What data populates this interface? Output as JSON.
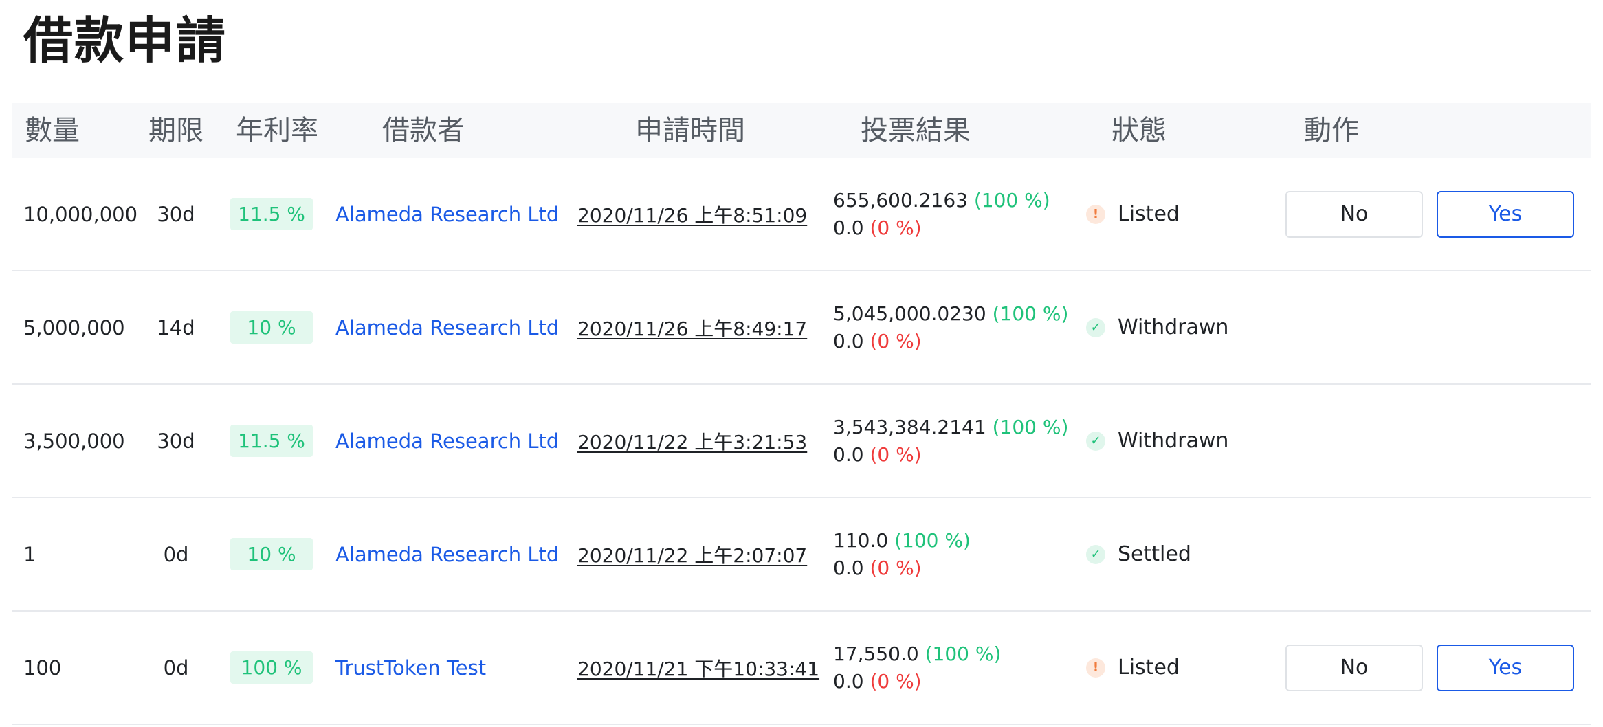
{
  "page": {
    "title": "借款申請"
  },
  "columns": [
    "數量",
    "期限",
    "年利率",
    "借款者",
    "申請時間",
    "投票結果",
    "狀態",
    "動作"
  ],
  "rows": [
    {
      "amount": "10,000,000",
      "term": "30d",
      "rate": "11.5 %",
      "borrower": "Alameda Research Ltd",
      "time": "2020/11/26 上午8:51:09",
      "yes_votes": "655,600.2163",
      "yes_pct": "(100 %)",
      "no_votes": "0.0",
      "no_pct": "(0 %)",
      "status": "Listed",
      "status_icon": "exclamation-icon",
      "show_actions": true
    },
    {
      "amount": "5,000,000",
      "term": "14d",
      "rate": "10 %",
      "borrower": "Alameda Research Ltd",
      "time": "2020/11/26 上午8:49:17",
      "yes_votes": "5,045,000.0230",
      "yes_pct": "(100 %)",
      "no_votes": "0.0",
      "no_pct": "(0 %)",
      "status": "Withdrawn",
      "status_icon": "check-icon",
      "show_actions": false
    },
    {
      "amount": "3,500,000",
      "term": "30d",
      "rate": "11.5 %",
      "borrower": "Alameda Research Ltd",
      "time": "2020/11/22 上午3:21:53",
      "yes_votes": "3,543,384.2141",
      "yes_pct": "(100 %)",
      "no_votes": "0.0",
      "no_pct": "(0 %)",
      "status": "Withdrawn",
      "status_icon": "check-icon",
      "show_actions": false
    },
    {
      "amount": "1",
      "term": "0d",
      "rate": "10 %",
      "borrower": "Alameda Research Ltd",
      "time": "2020/11/22 上午2:07:07",
      "yes_votes": "110.0",
      "yes_pct": "(100 %)",
      "no_votes": "0.0",
      "no_pct": "(0 %)",
      "status": "Settled",
      "status_icon": "check-icon",
      "show_actions": false
    },
    {
      "amount": "100",
      "term": "0d",
      "rate": "100 %",
      "borrower": "TrustToken Test",
      "time": "2020/11/21 下午10:33:41",
      "yes_votes": "17,550.0",
      "yes_pct": "(100 %)",
      "no_votes": "0.0",
      "no_pct": "(0 %)",
      "status": "Listed",
      "status_icon": "exclamation-icon",
      "show_actions": true
    }
  ],
  "actions": {
    "no_label": "No",
    "yes_label": "Yes"
  },
  "colors": {
    "link_blue": "#1a5ae6",
    "positive_green": "#1fc27a",
    "negative_red": "#ef3b3b",
    "warning_orange": "#f07a3c",
    "header_bg": "#f7f8fa"
  }
}
